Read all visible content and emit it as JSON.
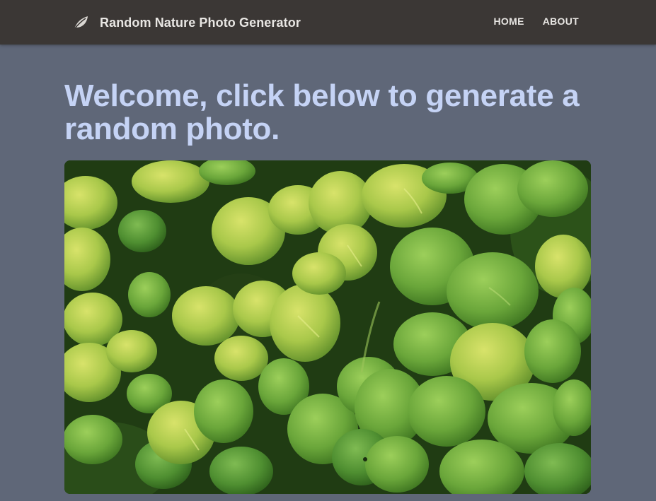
{
  "navbar": {
    "brand_icon": "leaf-icon",
    "brand_title": "Random Nature Photo Generator",
    "links": [
      {
        "label": "HOME"
      },
      {
        "label": "ABOUT"
      }
    ]
  },
  "main": {
    "headline": "Welcome, click below to generate a random photo.",
    "photo_subject": "green-leaves-photo"
  },
  "colors": {
    "navbar_bg": "#3b3735",
    "page_bg": "#5f6778",
    "headline": "#c5d3f5",
    "nav_text": "#e8e6e3"
  }
}
